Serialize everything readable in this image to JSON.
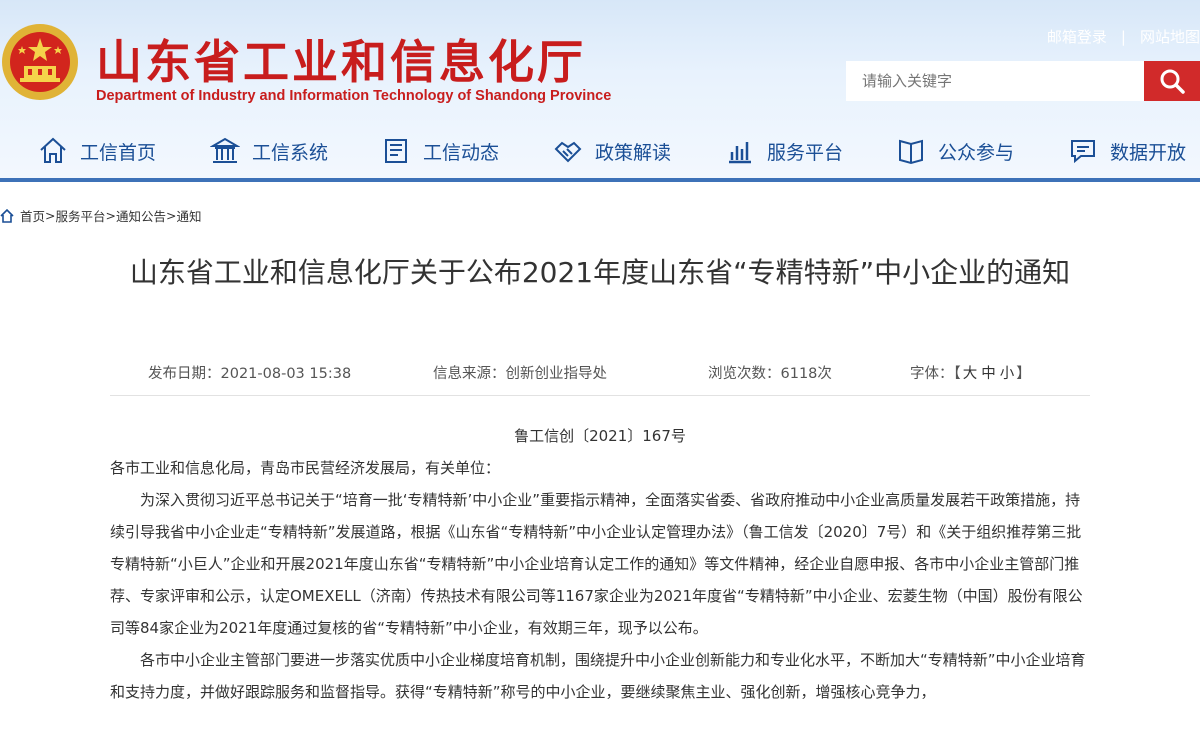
{
  "header": {
    "title_cn": "山东省工业和信息化厅",
    "title_en": "Department of Industry and Information Technology of Shandong Province",
    "brand_color": "#c81d1d",
    "links": [
      "邮箱登录",
      "网站地图"
    ],
    "link_sep": "|"
  },
  "search": {
    "placeholder": "请输入关键字",
    "button_icon": "search-icon"
  },
  "nav": {
    "color": "#1b4f96",
    "items": [
      {
        "label": "工信首页",
        "icon": "home-icon"
      },
      {
        "label": "工信系统",
        "icon": "building-icon"
      },
      {
        "label": "工信动态",
        "icon": "document-icon"
      },
      {
        "label": "政策解读",
        "icon": "handshake-icon"
      },
      {
        "label": "服务平台",
        "icon": "chart-icon"
      },
      {
        "label": "公众参与",
        "icon": "book-icon"
      },
      {
        "label": "数据开放",
        "icon": "chat-icon"
      }
    ]
  },
  "breadcrumb": {
    "items": [
      "首页",
      "服务平台",
      "通知公告",
      "通知"
    ],
    "sep": ">"
  },
  "article": {
    "title": "山东省工业和信息化厅关于公布2021年度山东省“专精特新”中小企业的通知",
    "meta": {
      "date_label": "发布日期：",
      "date": "2021-08-03 15:38",
      "source_label": "信息来源：",
      "source": "创新创业指导处",
      "views_label": "浏览次数：",
      "views": "6118次",
      "font_label": "字体：",
      "font_open": "【",
      "font_sizes": [
        "大",
        "中",
        "小"
      ],
      "font_close": "】"
    },
    "doc_no": "鲁工信创〔2021〕167号",
    "salutation": "各市工业和信息化局，青岛市民营经济发展局，有关单位：",
    "paragraphs": [
      "为深入贯彻习近平总书记关于“培育一批‘专精特新’中小企业”重要指示精神，全面落实省委、省政府推动中小企业高质量发展若干政策措施，持续引导我省中小企业走“专精特新”发展道路，根据《山东省“专精特新”中小企业认定管理办法》（鲁工信发〔2020〕7号）和《关于组织推荐第三批专精特新“小巨人”企业和开展2021年度山东省“专精特新”中小企业培育认定工作的通知》等文件精神，经企业自愿申报、各市中小企业主管部门推荐、专家评审和公示，认定OMEXELL（济南）传热技术有限公司等1167家企业为2021年度省“专精特新”中小企业、宏菱生物（中国）股份有限公司等84家企业为2021年度通过复核的省“专精特新”中小企业，有效期三年，现予以公布。",
      "各市中小企业主管部门要进一步落实优质中小企业梯度培育机制，围绕提升中小企业创新能力和专业化水平，不断加大“专精特新”中小企业培育和支持力度，并做好跟踪服务和监督指导。获得“专精特新”称号的中小企业，要继续聚焦主业、强化创新，增强核心竞争力，"
    ]
  }
}
